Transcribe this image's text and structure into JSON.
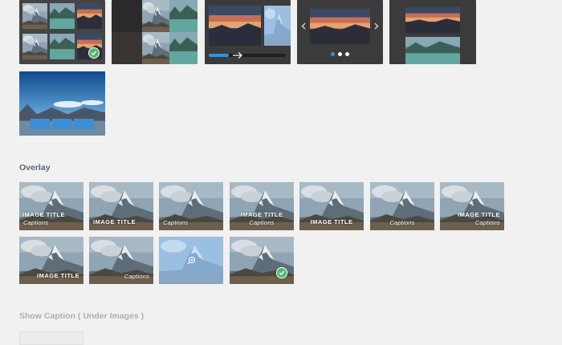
{
  "sections": {
    "overlay_title": "Overlay",
    "show_caption_title": "Show Caption ( Under Images )"
  },
  "overlay_options": [
    {
      "title": "IMAGE TITLE",
      "caption": "Captions"
    },
    {
      "title": "IMAGE TITLE",
      "caption": ""
    },
    {
      "title": "",
      "caption": "Captions"
    },
    {
      "title": "IMAGE TITLE",
      "caption": "Captions"
    },
    {
      "title": "IMAGE TITLE",
      "caption": ""
    },
    {
      "title": "",
      "caption": "Captions"
    },
    {
      "title": "IMAGE TITLE",
      "caption": "Captions"
    },
    {
      "title": "IMAGE TITLE",
      "caption": ""
    },
    {
      "title": "",
      "caption": "Captions"
    },
    {
      "title": "",
      "caption": ""
    },
    {
      "title": "",
      "caption": ""
    }
  ],
  "colors": {
    "accent_blue": "#3a8fd6",
    "selected_green": "#4cbb6c",
    "section_title": "#5d6873"
  },
  "icons": {
    "selected": "check-circle-icon",
    "zoom": "zoom-in-icon",
    "prev": "chevron-left-icon",
    "next": "chevron-right-icon",
    "arrow": "arrow-right-icon"
  }
}
